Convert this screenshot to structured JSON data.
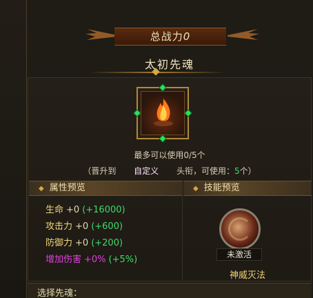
{
  "power": {
    "label": "总战力",
    "value": "0"
  },
  "soul": {
    "name": "太初先魂",
    "icon": "flame-icon"
  },
  "usage": {
    "text": "最多可以使用0/5个"
  },
  "promote": {
    "prefix": "（晋升到",
    "title": "自定义",
    "middle": "头衔，可使用：",
    "count": "5",
    "suffix": "个）"
  },
  "attributes": {
    "header": "属性预览",
    "rows": [
      {
        "name": "生命",
        "value": "+0",
        "bonus": "(+16000)"
      },
      {
        "name": "攻击力",
        "value": "+0",
        "bonus": "(+600)"
      },
      {
        "name": "防御力",
        "value": "+0",
        "bonus": "(+200)"
      },
      {
        "name": "增加伤害",
        "value": "+0%",
        "bonus": "(+5%)"
      }
    ]
  },
  "skill": {
    "header": "技能预览",
    "status": "未激活",
    "name": "神威灭法",
    "icon": "skill-orb-icon"
  },
  "select": {
    "label": "选择先魂："
  },
  "colors": {
    "gold": "#f0d478",
    "green": "#3ddc6a",
    "magenta": "#e040e0",
    "frame": "#b38a3c"
  }
}
